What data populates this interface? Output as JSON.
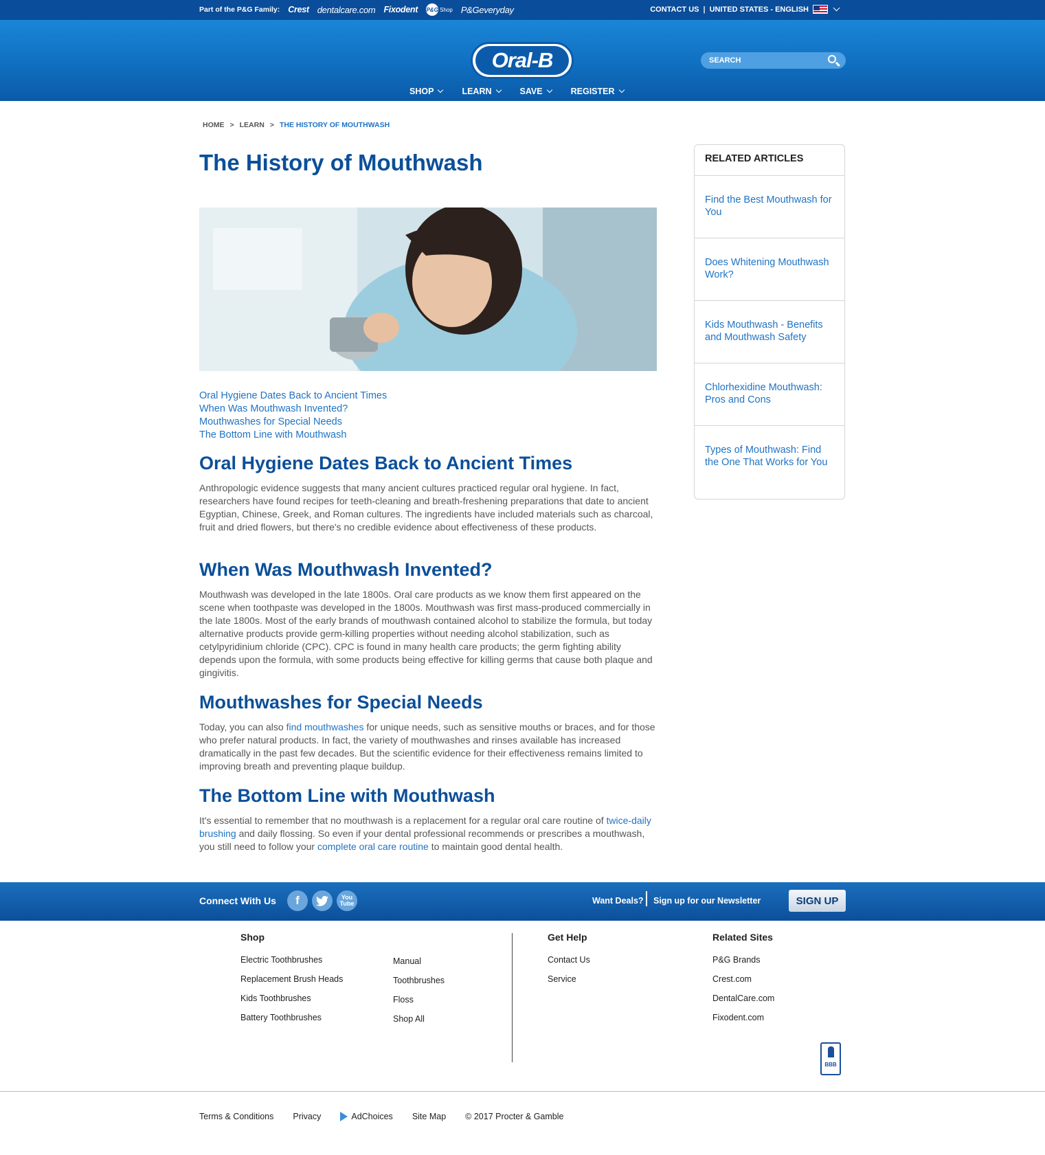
{
  "topbar": {
    "family_label": "Part of the P&G Family:",
    "brands": [
      "Crest",
      "dentalcare.com",
      "Fixodent",
      "P&G",
      "Shop",
      "P&Geveryday"
    ],
    "contact": "CONTACT US",
    "locale": "UNITED STATES - ENGLISH"
  },
  "header": {
    "logo": "Oral-B",
    "search_placeholder": "SEARCH",
    "nav": [
      "SHOP",
      "LEARN",
      "SAVE",
      "REGISTER"
    ]
  },
  "breadcrumb": {
    "home": "HOME",
    "sep": ">",
    "learn": "LEARN",
    "current": "THE HISTORY OF MOUTHWASH"
  },
  "article": {
    "title": "The History of Mouthwash",
    "toc": [
      "Oral Hygiene Dates Back to Ancient Times",
      "When Was Mouthwash Invented?",
      "Mouthwashes for Special Needs",
      "The Bottom Line with Mouthwash"
    ],
    "s1_heading": "Oral Hygiene Dates Back to Ancient Times",
    "s1_text": "Anthropologic evidence suggests that many ancient cultures practiced regular oral hygiene. In fact, researchers have found recipes for teeth-cleaning and breath-freshening preparations that date to ancient Egyptian, Chinese, Greek, and Roman cultures. The ingredients have included materials such as charcoal, fruit and dried flowers, but there's no credible evidence about effectiveness of these products.",
    "s2_heading": "When Was Mouthwash Invented?",
    "s2_text": "Mouthwash was developed in the late 1800s. Oral care products as we know them first appeared on the scene when toothpaste was developed in the 1800s. Mouthwash was first mass-produced commercially in the late 1800s. Most of the early brands of mouthwash contained alcohol to stabilize the formula, but today alternative products provide germ-killing properties without needing alcohol stabilization, such as cetylpyridinium chloride (CPC). CPC is found in many health care products; the germ fighting ability depends upon the formula, with some products being effective for killing germs that cause both plaque and gingivitis.",
    "s3_heading": "Mouthwashes for Special Needs",
    "s3_pre": "Today, you can also ",
    "s3_link": "find mouthwashes",
    "s3_post": " for unique needs, such as sensitive mouths or braces, and for those who prefer natural products. In fact, the variety of mouthwashes and rinses available has increased dramatically in the past few decades. But the scientific evidence for their effectiveness remains limited to improving breath and preventing plaque buildup.",
    "s4_heading": "The Bottom Line with Mouthwash",
    "s4_pre": "It's essential to remember that no mouthwash is a replacement for a regular oral care routine of ",
    "s4_link1": "twice-daily brushing",
    "s4_mid": " and daily flossing. So even if your dental professional recommends or prescribes a mouthwash, you still need to follow your ",
    "s4_link2": "complete oral care routine",
    "s4_post": " to maintain good dental health."
  },
  "related": {
    "heading": "RELATED ARTICLES",
    "items": [
      "Find the Best Mouthwash for You",
      "Does Whitening Mouthwash Work?",
      "Kids Mouthwash - Benefits and Mouthwash Safety",
      "Chlorhexidine Mouthwash: Pros and Cons",
      "Types of Mouthwash: Find the One That Works for You"
    ]
  },
  "connect": {
    "label": "Connect With Us",
    "social_icons": [
      "facebook-icon",
      "twitter-icon",
      "youtube-icon"
    ],
    "facebook": "f",
    "youtube_top": "You",
    "youtube_bottom": "Tube",
    "deals": "Want Deals?",
    "newsletter": "Sign up for our Newsletter",
    "signup": "SIGN UP"
  },
  "footer": {
    "shop_heading": "Shop",
    "shop_col1": [
      "Electric Toothbrushes",
      "Replacement Brush Heads",
      "Kids Toothbrushes",
      "Battery Toothbrushes"
    ],
    "shop_col2": [
      "Manual",
      "Toothbrushes",
      "Floss",
      "Shop All"
    ],
    "help_heading": "Get Help",
    "help": [
      "Contact Us",
      "Service"
    ],
    "related_heading": "Related Sites",
    "related_sites": [
      "P&G Brands",
      "Crest.com",
      "DentalCare.com",
      "Fixodent.com"
    ],
    "bbb": "BBB"
  },
  "legal": {
    "terms": "Terms & Conditions",
    "privacy": "Privacy",
    "adchoices": "AdChoices",
    "sitemap": "Site Map",
    "copyright": "© 2017 Procter & Gamble"
  },
  "colors": {
    "brand_blue": "#0b4f99",
    "link_blue": "#1f73c4",
    "header_blue": "#106fc0"
  }
}
